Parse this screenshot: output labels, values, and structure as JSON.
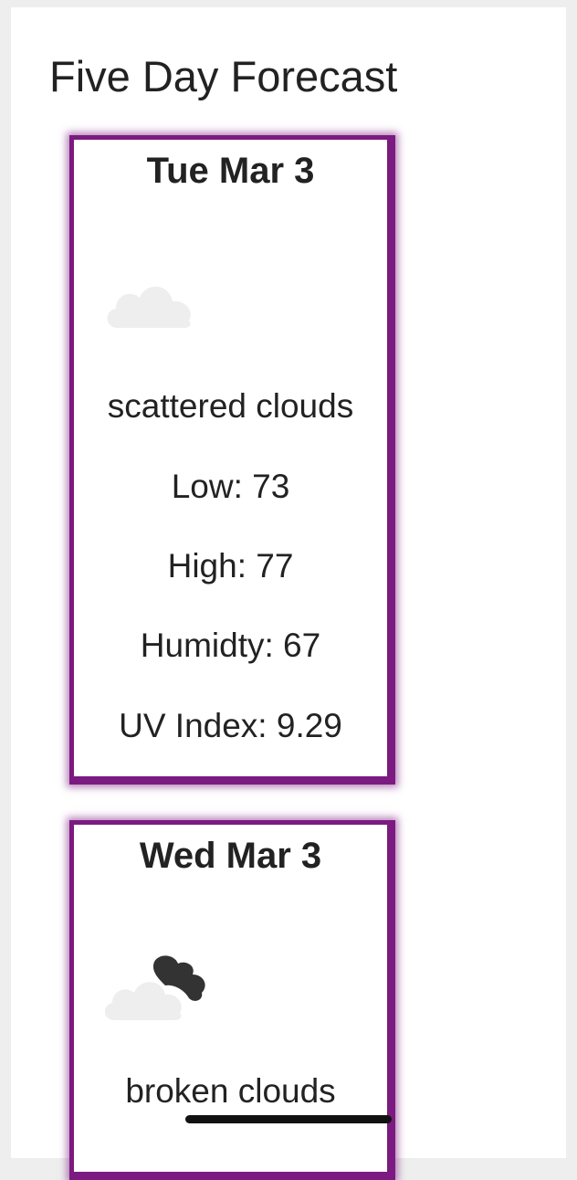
{
  "page": {
    "title": "Five Day Forecast"
  },
  "colors": {
    "card_border": "#7b1a80",
    "text": "#222222",
    "cloud_light": "#eeeeee",
    "cloud_dark": "#333333"
  },
  "forecast": [
    {
      "date": "Tue Mar 3",
      "icon": "scattered-clouds-icon",
      "description": "scattered clouds",
      "low": "Low: 73",
      "high": "High: 77",
      "humidity": "Humidty: 67",
      "uv": "UV Index: 9.29"
    },
    {
      "date": "Wed Mar 3",
      "icon": "broken-clouds-icon",
      "description": "broken clouds"
    }
  ]
}
